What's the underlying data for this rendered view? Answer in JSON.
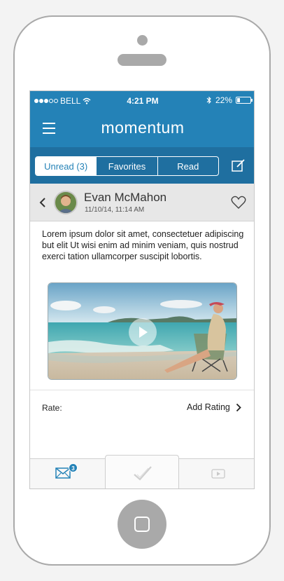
{
  "status_bar": {
    "carrier": "BELL",
    "time": "4:21 PM",
    "battery": "22%",
    "battery_level": 0.22,
    "signal_bars_filled": 3,
    "signal_bars_total": 5
  },
  "header": {
    "logo_text": "momentum"
  },
  "tabs": [
    {
      "label": "Unread (3)",
      "active": true
    },
    {
      "label": "Favorites",
      "active": false
    },
    {
      "label": "Read",
      "active": false
    }
  ],
  "message": {
    "sender": "Evan McMahon",
    "date": "11/10/14, 11:14 AM",
    "body": "Lorem ipsum dolor sit amet, consectetuer adipiscing but elit Ut wisi enim ad minim veniam, quis nostrud exerci tation ullamcorper suscipit lobortis."
  },
  "rating": {
    "label": "Rate:",
    "action": "Add Rating"
  },
  "bottom_nav": {
    "mail_badge": "3",
    "items": [
      "mail-icon",
      "check-icon",
      "video-icon"
    ]
  },
  "colors": {
    "primary": "#2482b7",
    "tab_bar": "#1f6fa0",
    "phone_frame": "#a9a9a9"
  }
}
